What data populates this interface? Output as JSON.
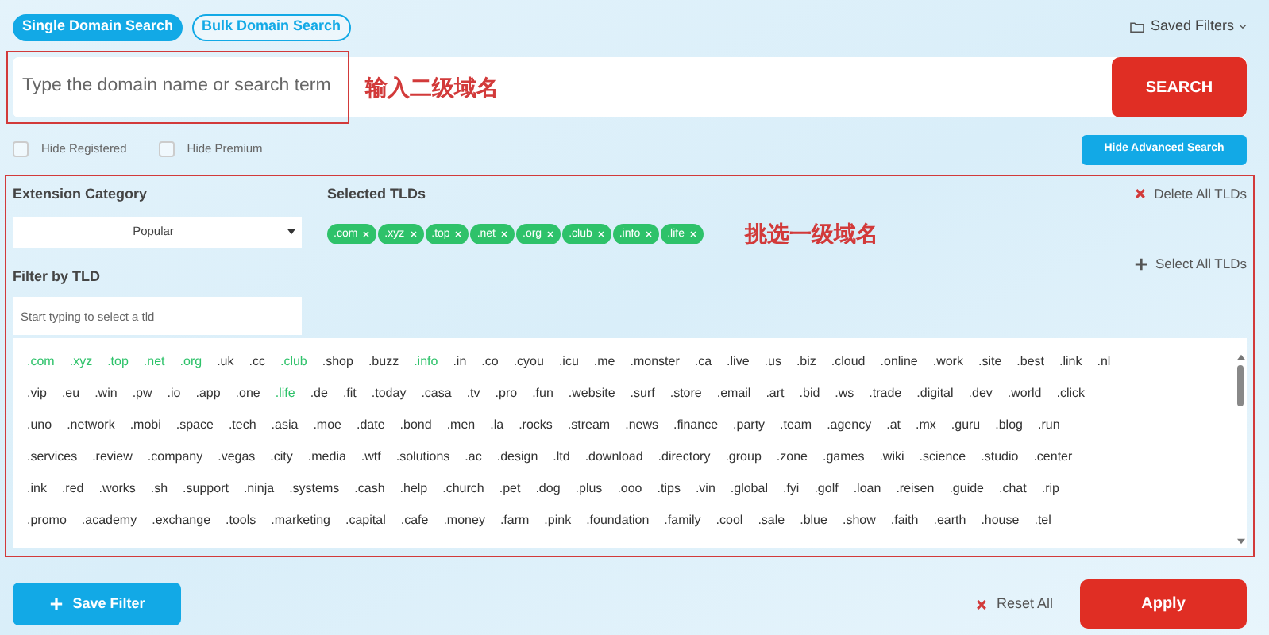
{
  "tabs": [
    {
      "label": "Single Domain Search",
      "selected": true
    },
    {
      "label": "Bulk Domain Search",
      "selected": false
    }
  ],
  "saved_filters": "Saved Filters",
  "search": {
    "placeholder": "Type the domain name or search term",
    "button": "SEARCH",
    "annotation": "输入二级域名"
  },
  "options": [
    {
      "label": "Hide Registered",
      "checked": false
    },
    {
      "label": "Hide Premium",
      "checked": false
    }
  ],
  "hide_advanced_button": "Hide Advanced Search",
  "extension_category": {
    "label": "Extension Category",
    "value": "Popular"
  },
  "filter_by_tld": {
    "label": "Filter by TLD",
    "placeholder": "Start typing to select a tld"
  },
  "selected_tlds": {
    "label": "Selected TLDs",
    "chips": [
      ".com",
      ".xyz",
      ".top",
      ".net",
      ".org",
      ".club",
      ".info",
      ".life"
    ],
    "annotation": "挑选一级域名",
    "delete_all": "Delete All TLDs",
    "select_all": "Select All TLDs"
  },
  "tld_rows": [
    [
      {
        "label": ".com",
        "selected": true
      },
      {
        "label": ".xyz",
        "selected": true
      },
      {
        "label": ".top",
        "selected": true
      },
      {
        "label": ".net",
        "selected": true
      },
      {
        "label": ".org",
        "selected": true
      },
      {
        "label": ".uk",
        "selected": false
      },
      {
        "label": ".cc",
        "selected": false
      },
      {
        "label": ".club",
        "selected": true
      },
      {
        "label": ".shop",
        "selected": false
      },
      {
        "label": ".buzz",
        "selected": false
      },
      {
        "label": ".info",
        "selected": true
      },
      {
        "label": ".in",
        "selected": false
      },
      {
        "label": ".co",
        "selected": false
      },
      {
        "label": ".cyou",
        "selected": false
      },
      {
        "label": ".icu",
        "selected": false
      },
      {
        "label": ".me",
        "selected": false
      },
      {
        "label": ".monster",
        "selected": false
      },
      {
        "label": ".ca",
        "selected": false
      },
      {
        "label": ".live",
        "selected": false
      },
      {
        "label": ".us",
        "selected": false
      },
      {
        "label": ".biz",
        "selected": false
      },
      {
        "label": ".cloud",
        "selected": false
      },
      {
        "label": ".online",
        "selected": false
      },
      {
        "label": ".work",
        "selected": false
      },
      {
        "label": ".site",
        "selected": false
      },
      {
        "label": ".best",
        "selected": false
      },
      {
        "label": ".link",
        "selected": false
      },
      {
        "label": ".nl",
        "selected": false
      }
    ],
    [
      {
        "label": ".vip",
        "selected": false
      },
      {
        "label": ".eu",
        "selected": false
      },
      {
        "label": ".win",
        "selected": false
      },
      {
        "label": ".pw",
        "selected": false
      },
      {
        "label": ".io",
        "selected": false
      },
      {
        "label": ".app",
        "selected": false
      },
      {
        "label": ".one",
        "selected": false
      },
      {
        "label": ".life",
        "selected": true
      },
      {
        "label": ".de",
        "selected": false
      },
      {
        "label": ".fit",
        "selected": false
      },
      {
        "label": ".today",
        "selected": false
      },
      {
        "label": ".casa",
        "selected": false
      },
      {
        "label": ".tv",
        "selected": false
      },
      {
        "label": ".pro",
        "selected": false
      },
      {
        "label": ".fun",
        "selected": false
      },
      {
        "label": ".website",
        "selected": false
      },
      {
        "label": ".surf",
        "selected": false
      },
      {
        "label": ".store",
        "selected": false
      },
      {
        "label": ".email",
        "selected": false
      },
      {
        "label": ".art",
        "selected": false
      },
      {
        "label": ".bid",
        "selected": false
      },
      {
        "label": ".ws",
        "selected": false
      },
      {
        "label": ".trade",
        "selected": false
      },
      {
        "label": ".digital",
        "selected": false
      },
      {
        "label": ".dev",
        "selected": false
      },
      {
        "label": ".world",
        "selected": false
      },
      {
        "label": ".click",
        "selected": false
      }
    ],
    [
      {
        "label": ".uno",
        "selected": false
      },
      {
        "label": ".network",
        "selected": false
      },
      {
        "label": ".mobi",
        "selected": false
      },
      {
        "label": ".space",
        "selected": false
      },
      {
        "label": ".tech",
        "selected": false
      },
      {
        "label": ".asia",
        "selected": false
      },
      {
        "label": ".moe",
        "selected": false
      },
      {
        "label": ".date",
        "selected": false
      },
      {
        "label": ".bond",
        "selected": false
      },
      {
        "label": ".men",
        "selected": false
      },
      {
        "label": ".la",
        "selected": false
      },
      {
        "label": ".rocks",
        "selected": false
      },
      {
        "label": ".stream",
        "selected": false
      },
      {
        "label": ".news",
        "selected": false
      },
      {
        "label": ".finance",
        "selected": false
      },
      {
        "label": ".party",
        "selected": false
      },
      {
        "label": ".team",
        "selected": false
      },
      {
        "label": ".agency",
        "selected": false
      },
      {
        "label": ".at",
        "selected": false
      },
      {
        "label": ".mx",
        "selected": false
      },
      {
        "label": ".guru",
        "selected": false
      },
      {
        "label": ".blog",
        "selected": false
      },
      {
        "label": ".run",
        "selected": false
      }
    ],
    [
      {
        "label": ".services",
        "selected": false
      },
      {
        "label": ".review",
        "selected": false
      },
      {
        "label": ".company",
        "selected": false
      },
      {
        "label": ".vegas",
        "selected": false
      },
      {
        "label": ".city",
        "selected": false
      },
      {
        "label": ".media",
        "selected": false
      },
      {
        "label": ".wtf",
        "selected": false
      },
      {
        "label": ".solutions",
        "selected": false
      },
      {
        "label": ".ac",
        "selected": false
      },
      {
        "label": ".design",
        "selected": false
      },
      {
        "label": ".ltd",
        "selected": false
      },
      {
        "label": ".download",
        "selected": false
      },
      {
        "label": ".directory",
        "selected": false
      },
      {
        "label": ".group",
        "selected": false
      },
      {
        "label": ".zone",
        "selected": false
      },
      {
        "label": ".games",
        "selected": false
      },
      {
        "label": ".wiki",
        "selected": false
      },
      {
        "label": ".science",
        "selected": false
      },
      {
        "label": ".studio",
        "selected": false
      },
      {
        "label": ".center",
        "selected": false
      }
    ],
    [
      {
        "label": ".ink",
        "selected": false
      },
      {
        "label": ".red",
        "selected": false
      },
      {
        "label": ".works",
        "selected": false
      },
      {
        "label": ".sh",
        "selected": false
      },
      {
        "label": ".support",
        "selected": false
      },
      {
        "label": ".ninja",
        "selected": false
      },
      {
        "label": ".systems",
        "selected": false
      },
      {
        "label": ".cash",
        "selected": false
      },
      {
        "label": ".help",
        "selected": false
      },
      {
        "label": ".church",
        "selected": false
      },
      {
        "label": ".pet",
        "selected": false
      },
      {
        "label": ".dog",
        "selected": false
      },
      {
        "label": ".plus",
        "selected": false
      },
      {
        "label": ".ooo",
        "selected": false
      },
      {
        "label": ".tips",
        "selected": false
      },
      {
        "label": ".vin",
        "selected": false
      },
      {
        "label": ".global",
        "selected": false
      },
      {
        "label": ".fyi",
        "selected": false
      },
      {
        "label": ".golf",
        "selected": false
      },
      {
        "label": ".loan",
        "selected": false
      },
      {
        "label": ".reisen",
        "selected": false
      },
      {
        "label": ".guide",
        "selected": false
      },
      {
        "label": ".chat",
        "selected": false
      },
      {
        "label": ".rip",
        "selected": false
      }
    ],
    [
      {
        "label": ".promo",
        "selected": false
      },
      {
        "label": ".academy",
        "selected": false
      },
      {
        "label": ".exchange",
        "selected": false
      },
      {
        "label": ".tools",
        "selected": false
      },
      {
        "label": ".marketing",
        "selected": false
      },
      {
        "label": ".capital",
        "selected": false
      },
      {
        "label": ".cafe",
        "selected": false
      },
      {
        "label": ".money",
        "selected": false
      },
      {
        "label": ".farm",
        "selected": false
      },
      {
        "label": ".pink",
        "selected": false
      },
      {
        "label": ".foundation",
        "selected": false
      },
      {
        "label": ".family",
        "selected": false
      },
      {
        "label": ".cool",
        "selected": false
      },
      {
        "label": ".sale",
        "selected": false
      },
      {
        "label": ".blue",
        "selected": false
      },
      {
        "label": ".show",
        "selected": false
      },
      {
        "label": ".faith",
        "selected": false
      },
      {
        "label": ".earth",
        "selected": false
      },
      {
        "label": ".house",
        "selected": false
      },
      {
        "label": ".tel",
        "selected": false
      }
    ]
  ],
  "footer": {
    "save_filter": "Save Filter",
    "reset_all": "Reset All",
    "apply": "Apply"
  }
}
